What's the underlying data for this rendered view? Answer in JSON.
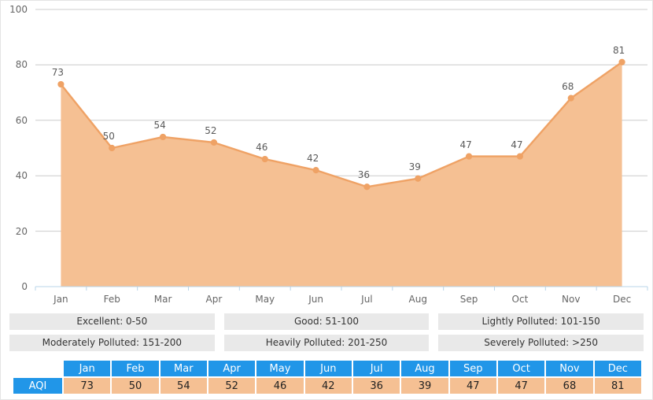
{
  "chart_data": {
    "type": "area",
    "title": "",
    "xlabel": "",
    "ylabel": "",
    "categories": [
      "Jan",
      "Feb",
      "Mar",
      "Apr",
      "May",
      "Jun",
      "Jul",
      "Aug",
      "Sep",
      "Oct",
      "Nov",
      "Dec"
    ],
    "values": [
      73,
      50,
      54,
      52,
      46,
      42,
      36,
      39,
      47,
      47,
      68,
      81
    ],
    "series": [
      {
        "name": "AQI",
        "values": [
          73,
          50,
          54,
          52,
          46,
          42,
          36,
          39,
          47,
          47,
          68,
          81
        ]
      }
    ],
    "ylim": [
      0,
      100
    ],
    "yticks": [
      0,
      20,
      40,
      60,
      80,
      100
    ],
    "ytick_labels": [
      "0",
      "20",
      "40",
      "60",
      "80",
      "100"
    ],
    "grid": true,
    "legend_position": "below-chart",
    "data_labels": true,
    "colors": {
      "line": "#efa265",
      "fill": "#f5c093",
      "marker": "#efa265",
      "grid": "#cccccc",
      "axis": "#b8d4e8",
      "tick_text": "#666666",
      "label_text": "#5a5a5a",
      "table_header": "#2196e8",
      "table_cell": "#f5c093",
      "legend_box": "#e9e9e9"
    }
  },
  "legend": {
    "items": [
      {
        "label": "Excellent: 0-50"
      },
      {
        "label": "Good: 51-100"
      },
      {
        "label": "Lightly Polluted: 101-150"
      },
      {
        "label": "Moderately Polluted: 151-200"
      },
      {
        "label": "Heavily Polluted: 201-250"
      },
      {
        "label": "Severely Polluted: >250"
      }
    ]
  },
  "table": {
    "corner_label": "",
    "row_label": "AQI",
    "columns": [
      "Jan",
      "Feb",
      "Mar",
      "Apr",
      "May",
      "Jun",
      "Jul",
      "Aug",
      "Sep",
      "Oct",
      "Nov",
      "Dec"
    ],
    "values": [
      "73",
      "50",
      "54",
      "52",
      "46",
      "42",
      "36",
      "39",
      "47",
      "47",
      "68",
      "81"
    ]
  }
}
